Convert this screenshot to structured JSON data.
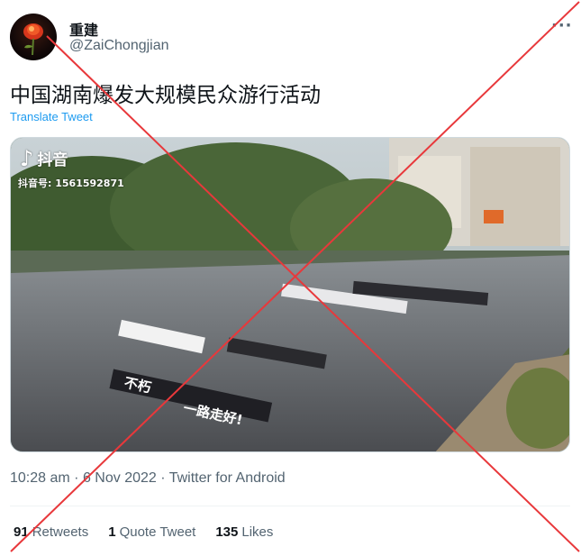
{
  "author": {
    "display_name": "重建",
    "handle": "@ZaiChongjian"
  },
  "tweet": {
    "text": "中国湖南爆发大规模民众游行活动",
    "translate_label": "Translate Tweet",
    "more_label": "···"
  },
  "media": {
    "watermark_brand": "抖音",
    "watermark_id": "抖音号: 1561592871",
    "banner_texts": [
      "不朽",
      "一路走好!"
    ]
  },
  "meta": {
    "time": "10:28 am",
    "date": "6 Nov 2022",
    "separator": "·",
    "source": "Twitter for Android"
  },
  "stats": {
    "retweets_count": "91",
    "retweets_label": "Retweets",
    "quotes_count": "1",
    "quotes_label": "Quote Tweet",
    "likes_count": "135",
    "likes_label": "Likes"
  },
  "overlay": {
    "x_color": "#e8383b"
  }
}
